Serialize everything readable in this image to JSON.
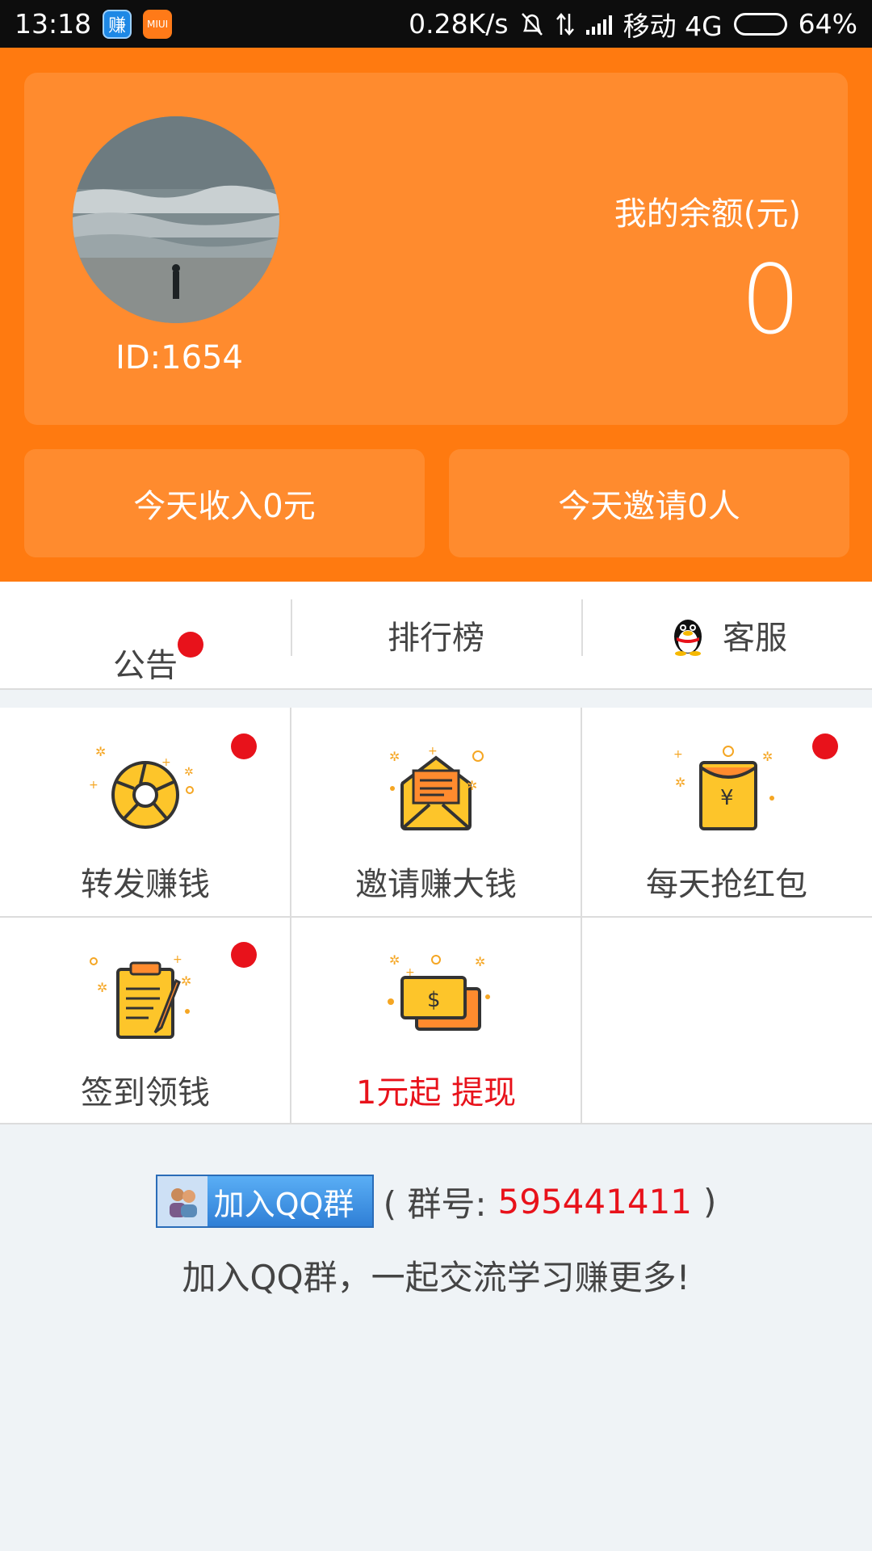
{
  "status_bar": {
    "time": "13:18",
    "app_icon_1": "赚",
    "app_icon_2": "MIUI",
    "net_speed": "0.28K/s",
    "carrier": "移动 4G",
    "battery": "64%",
    "battery_level": 0.64,
    "icons": [
      "mute-bell-icon",
      "data-arrows-icon",
      "signal-icon",
      "battery-icon"
    ]
  },
  "profile": {
    "user_id": "ID:1654",
    "balance_label": "我的余额(元)",
    "balance_value": "0"
  },
  "stats": {
    "today_income": "今天收入0元",
    "today_invites": "今天邀请0人"
  },
  "tabs": [
    {
      "label": "公告",
      "badge": true
    },
    {
      "label": "排行榜",
      "badge": false
    },
    {
      "label": "客服",
      "icon": "qq-penguin-icon",
      "badge": false
    }
  ],
  "grid": [
    {
      "label": "转发赚钱",
      "icon": "shutter-icon",
      "badge": true
    },
    {
      "label": "邀请赚大钱",
      "icon": "envelope-icon",
      "badge": false
    },
    {
      "label": "每天抢红包",
      "icon": "red-packet-icon",
      "badge": true
    },
    {
      "label": "签到领钱",
      "icon": "clipboard-icon",
      "badge": true
    },
    {
      "label": "1元起 提现",
      "icon": "cash-icon",
      "badge": false,
      "highlight": true
    }
  ],
  "qq_group": {
    "button_label": "加入QQ群",
    "prefix": "( 群号:",
    "number": "595441411",
    "suffix": ")",
    "tip": "加入QQ群，一起交流学习赚更多!"
  },
  "colors": {
    "header_orange": "#ff7a10",
    "card_orange": "#ff8b2e",
    "badge_red": "#e8121b",
    "icon_yellow": "#fdc52a",
    "background": "#eff3f6"
  }
}
